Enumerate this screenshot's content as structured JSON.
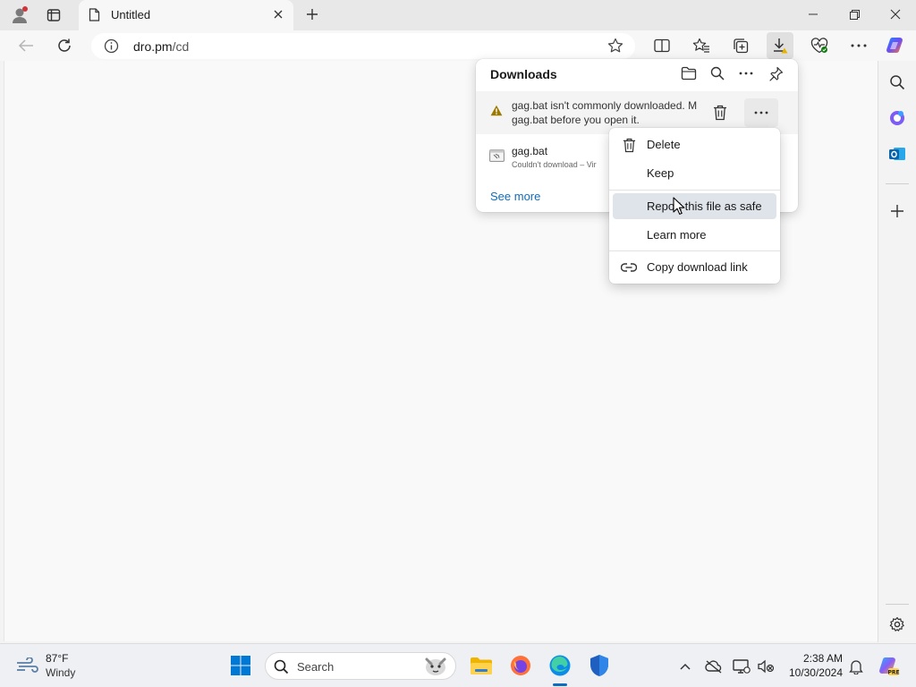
{
  "tab": {
    "title": "Untitled"
  },
  "address": {
    "domain": "dro.pm",
    "path": "/cd"
  },
  "downloads": {
    "title": "Downloads",
    "item1": {
      "line1": "gag.bat isn't commonly downloaded. M",
      "line2": "gag.bat before you open it."
    },
    "item2": {
      "filename": "gag.bat",
      "status": "Couldn't download – Vir"
    },
    "see_more": "See more"
  },
  "context_menu": {
    "items": [
      {
        "label": "Delete"
      },
      {
        "label": "Keep"
      },
      {
        "label": "Report this file as safe"
      },
      {
        "label": "Learn more"
      },
      {
        "label": "Copy download link"
      }
    ]
  },
  "taskbar": {
    "weather": {
      "temp": "87°F",
      "condition": "Windy"
    },
    "search_placeholder": "Search",
    "clock": {
      "time": "2:38 AM",
      "date": "10/30/2024"
    }
  },
  "colors": {
    "accent": "#0f6cbd",
    "warning": "#c29b00",
    "hover": "#dfe3ea"
  }
}
